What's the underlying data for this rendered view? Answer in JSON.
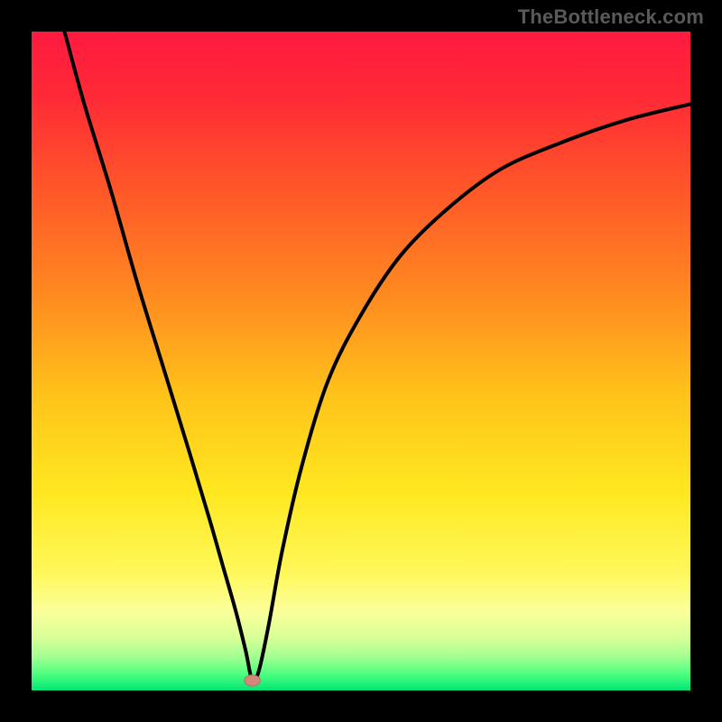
{
  "watermark": "TheBottleneck.com",
  "colors": {
    "bg_black": "#000000",
    "curve": "#000000",
    "marker_fill": "#d18a7a",
    "marker_stroke": "#b77565",
    "watermark": "#5a5a5a",
    "gradient_stops": [
      {
        "offset": 0.0,
        "color": "#ff1a3f"
      },
      {
        "offset": 0.1,
        "color": "#ff2a36"
      },
      {
        "offset": 0.25,
        "color": "#ff5a28"
      },
      {
        "offset": 0.4,
        "color": "#ff8a20"
      },
      {
        "offset": 0.55,
        "color": "#ffc21a"
      },
      {
        "offset": 0.7,
        "color": "#ffe820"
      },
      {
        "offset": 0.82,
        "color": "#fff85a"
      },
      {
        "offset": 0.88,
        "color": "#fbff9a"
      },
      {
        "offset": 0.92,
        "color": "#d8ff98"
      },
      {
        "offset": 0.95,
        "color": "#a0ff90"
      },
      {
        "offset": 0.975,
        "color": "#4dff7e"
      },
      {
        "offset": 1.0,
        "color": "#00e676"
      }
    ]
  },
  "chart_data": {
    "type": "line",
    "title": "",
    "xlabel": "",
    "ylabel": "",
    "xlim": [
      0,
      100
    ],
    "ylim": [
      0,
      100
    ],
    "grid": false,
    "series": [
      {
        "name": "bottleneck-curve",
        "x": [
          5,
          8,
          12,
          16,
          20,
          24,
          27,
          29,
          31,
          32.5,
          33.5,
          34.5,
          36,
          38,
          41,
          45,
          50,
          56,
          63,
          71,
          80,
          90,
          100
        ],
        "y": [
          100,
          89,
          76,
          62,
          49,
          36,
          26,
          19,
          12,
          6,
          1.5,
          3,
          10,
          21,
          34,
          47,
          57,
          66,
          73,
          79,
          83,
          86.5,
          89
        ]
      }
    ],
    "marker": {
      "x": 33.5,
      "y": 1.5,
      "r": 1.2
    },
    "legend": false
  }
}
